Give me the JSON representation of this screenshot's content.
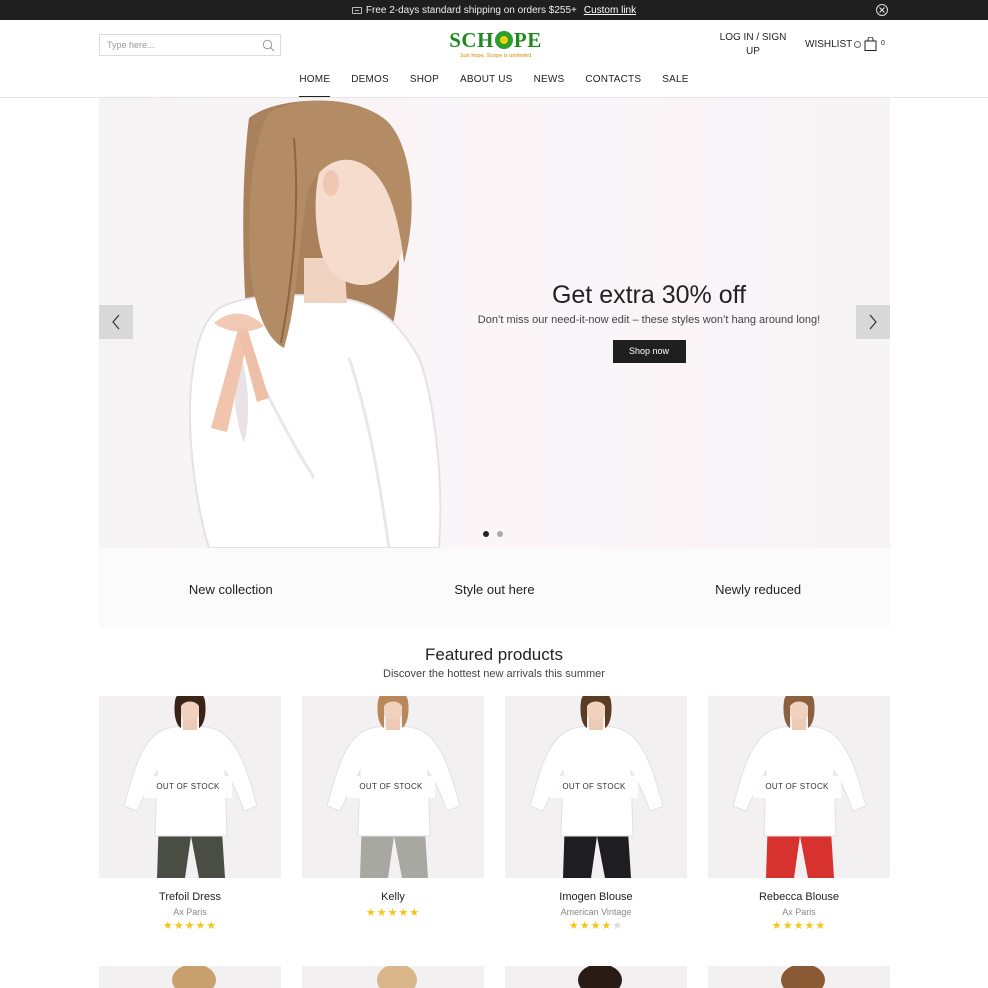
{
  "topbar": {
    "message": "Free 2-days standard shipping on orders $255+",
    "link": "Custom link"
  },
  "header": {
    "search_placeholder": "Type here...",
    "logo_prefix": "SCH",
    "logo_suffix": "PE",
    "logo_tagline": "Just hope, Scope is unlimited",
    "login": "LOG IN / SIGN UP",
    "wishlist": "WISHLIST",
    "cart_count": "0"
  },
  "nav": {
    "items": [
      "HOME",
      "DEMOS",
      "SHOP",
      "ABOUT US",
      "NEWS",
      "CONTACTS",
      "SALE"
    ],
    "active": "HOME"
  },
  "hero": {
    "title": "Get extra 30% off",
    "subtitle": "Don’t miss our need-it-now edit – these styles won’t hang around long!",
    "button": "Shop now",
    "slides": 2,
    "active_slide": 1
  },
  "banners": [
    "New collection",
    "Style out here",
    "Newly reduced"
  ],
  "featured": {
    "title": "Featured products",
    "subtitle": "Discover the hottest new arrivals this summer",
    "products": [
      {
        "name": "Trefoil Dress",
        "brand": "Ax Paris",
        "rating": 5,
        "badge": "OUT OF STOCK",
        "pants": "#4a4d44",
        "hair": "#3a2418"
      },
      {
        "name": "Kelly",
        "brand": "",
        "rating": 5,
        "badge": "OUT OF STOCK",
        "pants": "#a8a8a2",
        "hair": "#b9885a"
      },
      {
        "name": "Imogen Blouse",
        "brand": "American Vintage",
        "rating": 4,
        "badge": "OUT OF STOCK",
        "pants": "#1e1e22",
        "hair": "#5a3b25"
      },
      {
        "name": "Rebecca Blouse",
        "brand": "Ax Paris",
        "rating": 5,
        "badge": "OUT OF STOCK",
        "pants": "#d8322e",
        "hair": "#8a6040"
      }
    ]
  },
  "colors": {
    "accent_dark": "#1f1f1f",
    "logo_green": "#1e8a1e",
    "logo_yellow": "#f2d20f",
    "star": "#f5c518"
  }
}
